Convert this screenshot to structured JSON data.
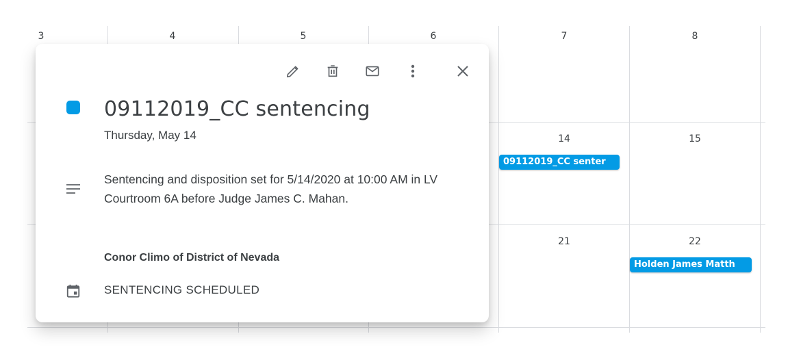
{
  "calendar": {
    "row1_days": [
      "3",
      "4",
      "5",
      "6",
      "7",
      "8"
    ],
    "row2_days": [
      "14",
      "15"
    ],
    "row3_days": [
      "21",
      "22"
    ],
    "events": {
      "chip_14": "09112019_CC senter",
      "chip_22": "Holden James Matth"
    },
    "event_color": "#039be5"
  },
  "popup": {
    "title": "09112019_CC sentencing",
    "date": "Thursday, May 14",
    "description": "Sentencing and disposition set for 5/14/2020 at 10:00 AM in LV Courtroom 6A before Judge James C. Mahan.",
    "organizer": "Conor Climo of District of Nevada",
    "calendar_status": "SENTENCING SCHEDULED",
    "toolbar_icons": [
      "edit-icon",
      "delete-icon",
      "email-icon",
      "more-options-icon",
      "close-icon"
    ],
    "color": "#039be5"
  }
}
